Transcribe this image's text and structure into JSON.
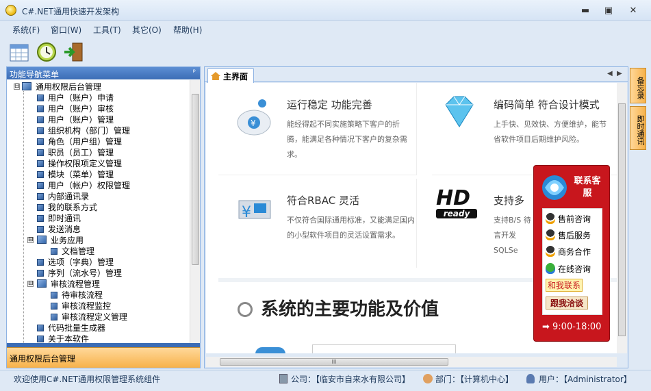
{
  "window": {
    "title": "C#.NET通用快速开发架构",
    "minimize": "▬",
    "maximize": "▣",
    "close": "✕"
  },
  "menu": [
    "系统(F)",
    "窗口(W)",
    "工具(T)",
    "其它(O)",
    "帮助(H)"
  ],
  "toolbar": [
    {
      "icon": "calendar-grid-icon"
    },
    {
      "icon": "clock-refresh-icon"
    },
    {
      "icon": "exit-door-icon"
    }
  ],
  "nav": {
    "header": "功能导航菜单",
    "pin": "ᵖ",
    "tree": [
      {
        "label": "通用权限后台管理",
        "level": 0,
        "folder": true,
        "expander": "⊟"
      },
      {
        "label": "用户（账户）申请",
        "level": 1
      },
      {
        "label": "用户（账户）审核",
        "level": 1
      },
      {
        "label": "用户（账户）管理",
        "level": 1
      },
      {
        "label": "组织机构（部门）管理",
        "level": 1
      },
      {
        "label": "角色（用户组）管理",
        "level": 1
      },
      {
        "label": "职员（员工）管理",
        "level": 1
      },
      {
        "label": "操作权限项定义管理",
        "level": 1
      },
      {
        "label": "模块（菜单）管理",
        "level": 1
      },
      {
        "label": "用户（帐户）权限管理",
        "level": 1
      },
      {
        "label": "内部通讯录",
        "level": 1
      },
      {
        "label": "我的联系方式",
        "level": 1
      },
      {
        "label": "即时通讯",
        "level": 1
      },
      {
        "label": "发送消息",
        "level": 1
      },
      {
        "label": "业务应用",
        "level": 1,
        "folder": true,
        "expander": "⊟"
      },
      {
        "label": "文档管理",
        "level": 2
      },
      {
        "label": "选项（字典）管理",
        "level": 1
      },
      {
        "label": "序列（流水号）管理",
        "level": 1
      },
      {
        "label": "审核流程管理",
        "level": 1,
        "folder": true,
        "expander": "⊟"
      },
      {
        "label": "待审核流程",
        "level": 2
      },
      {
        "label": "审核流程监控",
        "level": 2
      },
      {
        "label": "审核流程定义管理",
        "level": 2
      },
      {
        "label": "代码批量生成器",
        "level": 1
      },
      {
        "label": "关于本软件",
        "level": 1
      }
    ],
    "group": "通用权限后台管理"
  },
  "tabs": {
    "home": "主界面",
    "prev": "◀",
    "next": "▶"
  },
  "features": [
    {
      "title": "运行稳定 功能完善",
      "desc": "能经得起不同实施策略下客户的折腾，能满足各种情况下客户的复杂需求。",
      "icon": "piggy-bank-icon"
    },
    {
      "title": "编码简单 符合设计模式",
      "desc": "上手快、见效快、方便维护，能节省软件项目后期维护风险。",
      "icon": "diamond-icon"
    },
    {
      "title": "符合RBAC 灵活",
      "desc": "不仅符合国际通用标准，又能满足国内的小型软件项目的灵活设置需求。",
      "icon": "money-box-icon"
    },
    {
      "title": "支持多",
      "desc": "支持B/S 待言开发 SQLSe",
      "icon": "hd-ready-icon",
      "badge": "HD",
      "badge2": "ready"
    }
  ],
  "value_title": "系统的主要功能及价值",
  "hscroll_grip": "III",
  "right_tabs": [
    "备忘录",
    "即时通讯"
  ],
  "customer_service": {
    "title": "联系客服",
    "items": [
      "售前咨询",
      "售后服务",
      "商务合作",
      "在线咨询",
      "和我联系",
      "跟我洽谈"
    ],
    "hours": "➡ 9:00-18:00"
  },
  "status": {
    "welcome": "欢迎使用C#.NET通用权限管理系统组件",
    "company": "公司：【临安市自来水有限公司】",
    "department": "部门：【计算机中心】",
    "user": "用户：【Administrator】"
  }
}
